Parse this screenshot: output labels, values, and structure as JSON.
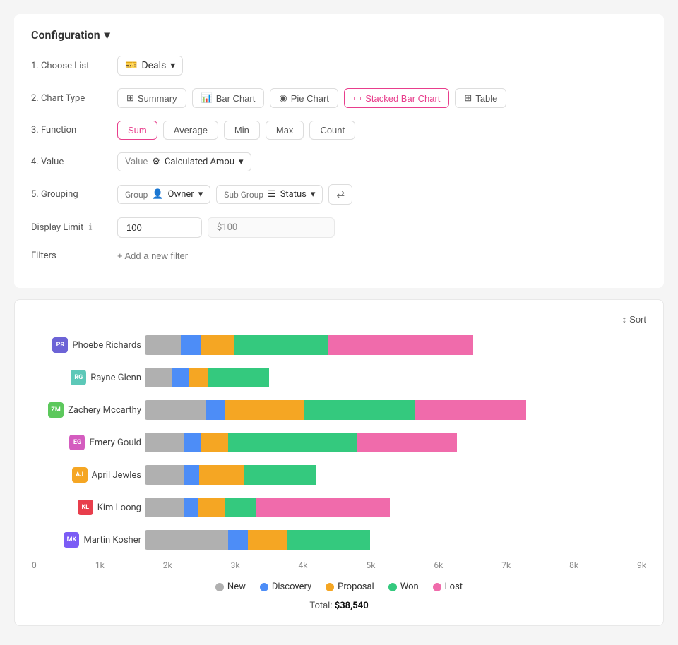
{
  "config": {
    "title": "Configuration",
    "rows": [
      {
        "label": "1. Choose List"
      },
      {
        "label": "2. Chart Type"
      },
      {
        "label": "3. Function"
      },
      {
        "label": "4. Value"
      },
      {
        "label": "5. Grouping"
      },
      {
        "label": "Display Limit"
      },
      {
        "label": "Filters"
      }
    ],
    "chooselist": {
      "value": "Deals",
      "icon": "💳"
    },
    "chartTypes": [
      {
        "id": "summary",
        "label": "Summary",
        "icon": "⊞",
        "active": false
      },
      {
        "id": "bar",
        "label": "Bar Chart",
        "icon": "📊",
        "active": false
      },
      {
        "id": "pie",
        "label": "Pie Chart",
        "icon": "🥧",
        "active": false
      },
      {
        "id": "stacked",
        "label": "Stacked Bar Chart",
        "icon": "▭",
        "active": true
      },
      {
        "id": "table",
        "label": "Table",
        "icon": "⊞",
        "active": false
      }
    ],
    "functions": [
      {
        "label": "Sum",
        "active": true
      },
      {
        "label": "Average",
        "active": false
      },
      {
        "label": "Min",
        "active": false
      },
      {
        "label": "Max",
        "active": false
      },
      {
        "label": "Count",
        "active": false
      }
    ],
    "value": {
      "prefix": "Value",
      "selected": "Calculated Amou"
    },
    "grouping": {
      "groupLabel": "Group",
      "groupValue": "Owner",
      "subGroupLabel": "Sub Group",
      "subGroupValue": "Status"
    },
    "displayLimit": {
      "inputValue": "100",
      "displayValue": "$100"
    },
    "filters": {
      "addLabel": "+ Add a new filter"
    }
  },
  "chart": {
    "sortLabel": "Sort",
    "maxValue": 9000,
    "xAxisLabels": [
      "0",
      "1k",
      "2k",
      "3k",
      "4k",
      "5k",
      "6k",
      "7k",
      "8k",
      "9k"
    ],
    "bars": [
      {
        "name": "Phoebe Richards",
        "initials": "PR",
        "avatarColor": "#6c63d6",
        "segments": [
          {
            "type": "new",
            "value": 650,
            "color": "#b0b0b0"
          },
          {
            "type": "discovery",
            "value": 350,
            "color": "#4d8df7"
          },
          {
            "type": "proposal",
            "value": 600,
            "color": "#f5a623"
          },
          {
            "type": "won",
            "value": 1700,
            "color": "#34c97e"
          },
          {
            "type": "lost",
            "value": 2600,
            "color": "#f06bab"
          }
        ]
      },
      {
        "name": "Rayne Glenn",
        "initials": "RG",
        "avatarColor": "#5cc8b8",
        "segments": [
          {
            "type": "new",
            "value": 500,
            "color": "#b0b0b0"
          },
          {
            "type": "discovery",
            "value": 280,
            "color": "#4d8df7"
          },
          {
            "type": "proposal",
            "value": 350,
            "color": "#f5a623"
          },
          {
            "type": "won",
            "value": 1100,
            "color": "#34c97e"
          },
          {
            "type": "lost",
            "value": 0,
            "color": "#f06bab"
          }
        ]
      },
      {
        "name": "Zachery Mccarthy",
        "initials": "ZM",
        "avatarColor": "#5cc85c",
        "segments": [
          {
            "type": "new",
            "value": 1100,
            "color": "#b0b0b0"
          },
          {
            "type": "discovery",
            "value": 350,
            "color": "#4d8df7"
          },
          {
            "type": "proposal",
            "value": 1400,
            "color": "#f5a623"
          },
          {
            "type": "won",
            "value": 2000,
            "color": "#34c97e"
          },
          {
            "type": "lost",
            "value": 2000,
            "color": "#f06bab"
          }
        ]
      },
      {
        "name": "Emery Gould",
        "initials": "EG",
        "avatarColor": "#d45cbf",
        "segments": [
          {
            "type": "new",
            "value": 700,
            "color": "#b0b0b0"
          },
          {
            "type": "discovery",
            "value": 300,
            "color": "#4d8df7"
          },
          {
            "type": "proposal",
            "value": 500,
            "color": "#f5a623"
          },
          {
            "type": "won",
            "value": 2300,
            "color": "#34c97e"
          },
          {
            "type": "lost",
            "value": 1800,
            "color": "#f06bab"
          }
        ]
      },
      {
        "name": "April Jewles",
        "initials": "AJ",
        "avatarColor": "#f5a623",
        "segments": [
          {
            "type": "new",
            "value": 700,
            "color": "#b0b0b0"
          },
          {
            "type": "discovery",
            "value": 280,
            "color": "#4d8df7"
          },
          {
            "type": "proposal",
            "value": 800,
            "color": "#f5a623"
          },
          {
            "type": "won",
            "value": 1300,
            "color": "#34c97e"
          },
          {
            "type": "lost",
            "value": 0,
            "color": "#f06bab"
          }
        ]
      },
      {
        "name": "Kim Loong",
        "initials": "KL",
        "avatarColor": "#e83e4c",
        "segments": [
          {
            "type": "new",
            "value": 700,
            "color": "#b0b0b0"
          },
          {
            "type": "discovery",
            "value": 250,
            "color": "#4d8df7"
          },
          {
            "type": "proposal",
            "value": 500,
            "color": "#f5a623"
          },
          {
            "type": "won",
            "value": 550,
            "color": "#34c97e"
          },
          {
            "type": "lost",
            "value": 2400,
            "color": "#f06bab"
          }
        ]
      },
      {
        "name": "Martin Kosher",
        "initials": "MK",
        "avatarColor": "#7b5cf5",
        "segments": [
          {
            "type": "new",
            "value": 1500,
            "color": "#b0b0b0"
          },
          {
            "type": "discovery",
            "value": 350,
            "color": "#4d8df7"
          },
          {
            "type": "proposal",
            "value": 700,
            "color": "#f5a623"
          },
          {
            "type": "won",
            "value": 1500,
            "color": "#34c97e"
          },
          {
            "type": "lost",
            "value": 0,
            "color": "#f06bab"
          }
        ]
      }
    ],
    "legend": [
      {
        "label": "New",
        "color": "#b0b0b0"
      },
      {
        "label": "Discovery",
        "color": "#4d8df7"
      },
      {
        "label": "Proposal",
        "color": "#f5a623"
      },
      {
        "label": "Won",
        "color": "#34c97e"
      },
      {
        "label": "Lost",
        "color": "#f06bab"
      }
    ],
    "total": {
      "label": "Total:",
      "value": "$38,540"
    }
  }
}
